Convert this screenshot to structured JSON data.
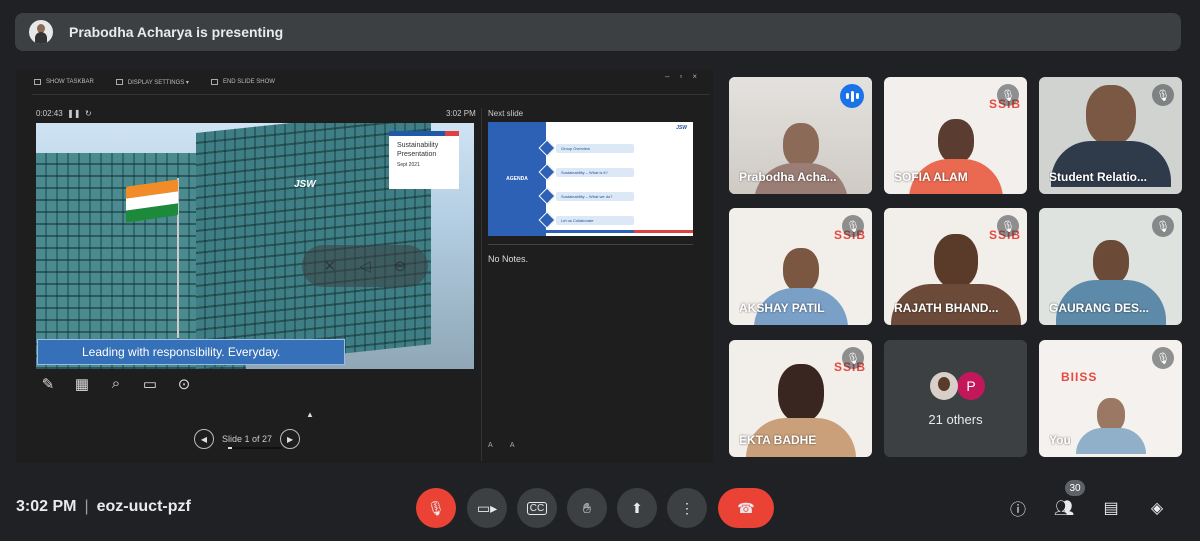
{
  "banner": {
    "presenter_text": "Prabodha Acharya is presenting"
  },
  "presentation": {
    "toolbar": {
      "show_taskbar": "SHOW TASKBAR",
      "display_settings": "DISPLAY SETTINGS ▾",
      "end_slide_show": "END SLIDE SHOW"
    },
    "timer": "0:02:43",
    "clock": "3:02 PM",
    "slide": {
      "title_line1": "Sustainability",
      "title_line2": "Presentation",
      "date": "Sept 2021",
      "logo": "JSW",
      "tagline": "Leading with  responsibility.  Everyday."
    },
    "next_slide_label": "Next slide",
    "next_slide": {
      "heading": "AGENDA",
      "items": [
        "Group Overview",
        "Sustainability – What is it?",
        "Sustainability – What we do?",
        "Let us Collaborate"
      ],
      "logo": "JSW"
    },
    "notes": "No Notes.",
    "slide_counter": "Slide 1 of 27",
    "font_controls": "A A"
  },
  "participants": [
    {
      "name": "Prabodha Acha...",
      "speaking": true
    },
    {
      "name": "SOFIA ALAM",
      "muted": true
    },
    {
      "name": "Student Relatio...",
      "muted": true
    },
    {
      "name": "AKSHAY PATIL",
      "muted": true
    },
    {
      "name": "RAJATH BHAND...",
      "muted": true
    },
    {
      "name": "GAURANG DES...",
      "muted": true
    },
    {
      "name": "EKTA BADHE",
      "muted": true
    },
    {
      "others_initial": "P",
      "others_text": "21 others"
    },
    {
      "name": "You",
      "muted": true
    }
  ],
  "background_logo": "SSIB",
  "background_logo_mirrored": "BIISS",
  "bottom": {
    "time": "3:02 PM",
    "separator": "|",
    "meeting_code": "eoz-uuct-pzf",
    "people_count": "30"
  },
  "colors": {
    "accent": "#1a73e8",
    "danger": "#ea4335",
    "surface": "#3c4043",
    "background": "#202124"
  }
}
